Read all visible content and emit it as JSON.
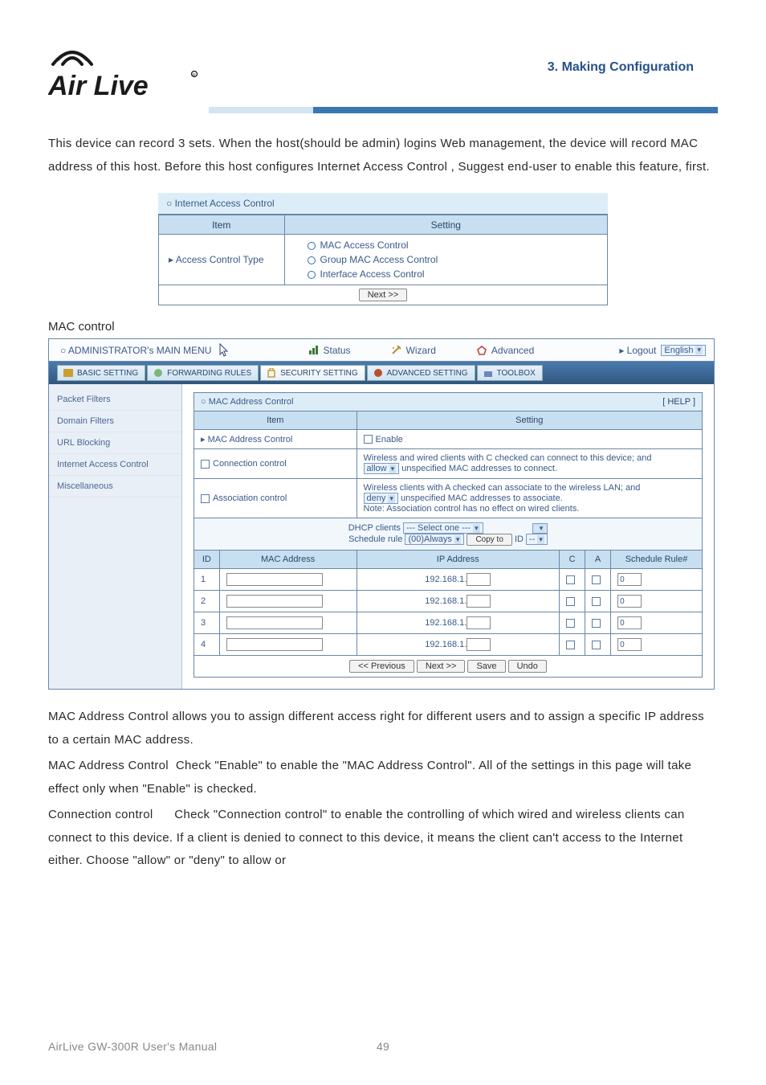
{
  "header": {
    "chapter": "3. Making Configuration",
    "brand": "Air Live"
  },
  "intro": {
    "p1": "This device can record 3 sets. When the host(should be admin) logins Web management, the device will record MAC address of this host. Before this host configures Internet Access Control , Suggest end-user to enable this feature, first."
  },
  "box1": {
    "caption": "Internet Access Control",
    "col1": "Item",
    "col2": "Setting",
    "row_label": "▸ Access Control Type",
    "opt1": "MAC Access Control",
    "opt2": "Group MAC Access Control",
    "opt3": "Interface Access Control",
    "next": "Next >>"
  },
  "sec_title": "MAC control",
  "admin": {
    "title": "ADMINISTRATOR's MAIN MENU",
    "tabs": {
      "status": "Status",
      "wizard": "Wizard",
      "advanced": "Advanced"
    },
    "logout": "▸ Logout",
    "lang": "English",
    "subtabs": {
      "basic": "BASIC SETTING",
      "fwd": "FORWARDING RULES",
      "sec": "SECURITY SETTING",
      "adv": "ADVANCED SETTING",
      "tool": "TOOLBOX"
    },
    "sidebar": [
      "Packet Filters",
      "Domain Filters",
      "URL Blocking",
      "Internet Access Control",
      "Miscellaneous"
    ],
    "mac": {
      "caption": "MAC Address Control",
      "help": "[ HELP ]",
      "col_item": "Item",
      "col_setting": "Setting",
      "r1_label": "MAC Address Control",
      "r1_val": "Enable",
      "r2_label": "Connection control",
      "r2_txt1": "Wireless and wired clients with C checked can connect to this device; and",
      "r2_sel": "allow",
      "r2_txt2": "unspecified MAC addresses to connect.",
      "r3_label": "Association control",
      "r3_txt1": "Wireless clients with A checked can associate to the wireless LAN; and",
      "r3_sel": "deny",
      "r3_txt2": "unspecified MAC addresses to associate.",
      "r3_txt3": "Note: Association control has no effect on wired clients.",
      "dhcp_label": "DHCP clients",
      "dhcp_sel": "--- Select one ---",
      "sched_label": "Schedule rule",
      "sched_sel": "(00)Always",
      "copy_btn": "Copy to",
      "id_label": "ID",
      "id_sel": "--",
      "th_id": "ID",
      "th_mac": "MAC Address",
      "th_ip": "IP Address",
      "th_c": "C",
      "th_a": "A",
      "th_rule": "Schedule Rule#",
      "rows": [
        {
          "id": "1",
          "ip": "192.168.1.",
          "rule": "0"
        },
        {
          "id": "2",
          "ip": "192.168.1.",
          "rule": "0"
        },
        {
          "id": "3",
          "ip": "192.168.1.",
          "rule": "0"
        },
        {
          "id": "4",
          "ip": "192.168.1.",
          "rule": "0"
        }
      ],
      "btn_prev": "<< Previous",
      "btn_next": "Next >>",
      "btn_save": "Save",
      "btn_undo": "Undo"
    }
  },
  "outro": {
    "p1": "MAC Address Control allows you to assign different access right for different users and to assign a specific IP address to a certain MAC address.",
    "p2a": "MAC Address Control",
    "p2b": "Check \"Enable\" to enable the \"MAC Address Control\". All of the settings in this page will take effect only when \"Enable\" is checked.",
    "p3a": "Connection control",
    "p3b": "Check \"Connection control\" to enable the controlling of which wired and wireless clients can connect to this device. If a client is denied to connect to this device, it means the client can't access to the Internet either. Choose \"allow\" or \"deny\" to allow or"
  },
  "footer": {
    "left": "AirLive GW-300R User's Manual",
    "right": "49"
  }
}
